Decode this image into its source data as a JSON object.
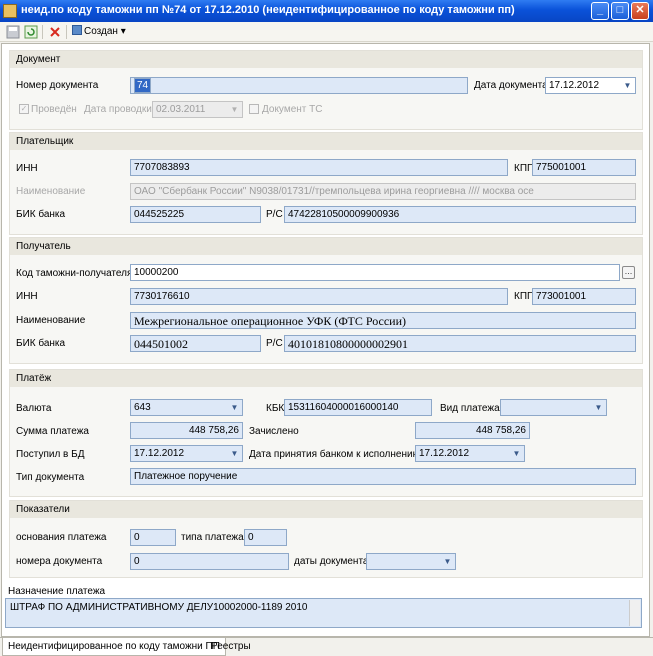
{
  "window": {
    "title": "неид.по коду таможни пп №74 от 17.12.2010 (неидентифицированное по коду таможни пп)"
  },
  "toolbar": {
    "created_label": "Создан"
  },
  "document": {
    "header": "Документ",
    "doc_number_label": "Номер документа",
    "doc_number": "74",
    "doc_date_label": "Дата документа",
    "doc_date": "17.12.2012",
    "posted_label": "Проведён",
    "post_date_label": "Дата проводки",
    "post_date": "02.03.2011",
    "ts_doc_label": "Документ ТС"
  },
  "payer": {
    "header": "Плательщик",
    "inn_label": "ИНН",
    "inn": "7707083893",
    "kpp_label": "КПП",
    "kpp": "775001001",
    "name_label": "Наименование",
    "name": "ОАО \"Сбербанк России\" N9038/01731//тремпольцева ирина георгиевна //// москва осе",
    "bik_label": "БИК банка",
    "bik": "044525225",
    "rs_label": "Р/С",
    "rs": "47422810500009900936"
  },
  "receiver": {
    "header": "Получатель",
    "customs_code_label": "Код таможни-получателя",
    "customs_code": "10000200",
    "inn_label": "ИНН",
    "inn": "7730176610",
    "kpp_label": "КПП",
    "kpp": "773001001",
    "name_label": "Наименование",
    "name": "Межрегиональное операционное УФК (ФТС России)",
    "bik_label": "БИК банка",
    "bik": "044501002",
    "rs_label": "Р/С",
    "rs": "40101810800000002901"
  },
  "payment": {
    "header": "Платёж",
    "currency_label": "Валюта",
    "currency": "643",
    "kbk_label": "КБК",
    "kbk": "15311604000016000140",
    "pay_kind_label": "Вид платежа",
    "pay_kind": "",
    "amount_label": "Сумма платежа",
    "amount": "448 758,26",
    "credited_label": "Зачислено",
    "credited": "448 758,26",
    "received_label": "Поступил в БД",
    "received": "17.12.2012",
    "accepted_label": "Дата принятия банком к исполнению",
    "accepted": "17.12.2012",
    "doc_type_label": "Тип документа",
    "doc_type": "Платежное поручение"
  },
  "indicators": {
    "header": "Показатели",
    "basis_label": "основания платежа",
    "basis": "0",
    "type_label": "типа платежа",
    "type": "0",
    "doc_num_label": "номера документа",
    "doc_num": "0",
    "doc_date_label": "даты документа",
    "doc_date": ""
  },
  "purpose": {
    "label": "Назначение платежа",
    "text": "ШТРАФ ПО АДМИНИСТРАТИВНОМУ ДЕЛУ10002000-1189 2010"
  },
  "tabs": [
    "Неидентифицированное по коду таможни ПП",
    "Реестры"
  ],
  "icons": [
    "app-icon",
    "save-icon",
    "refresh-icon",
    "delete-icon",
    "created-icon",
    "minimize-icon",
    "maximize-icon",
    "close-icon",
    "chevron-down-icon",
    "ellipsis-icon"
  ]
}
